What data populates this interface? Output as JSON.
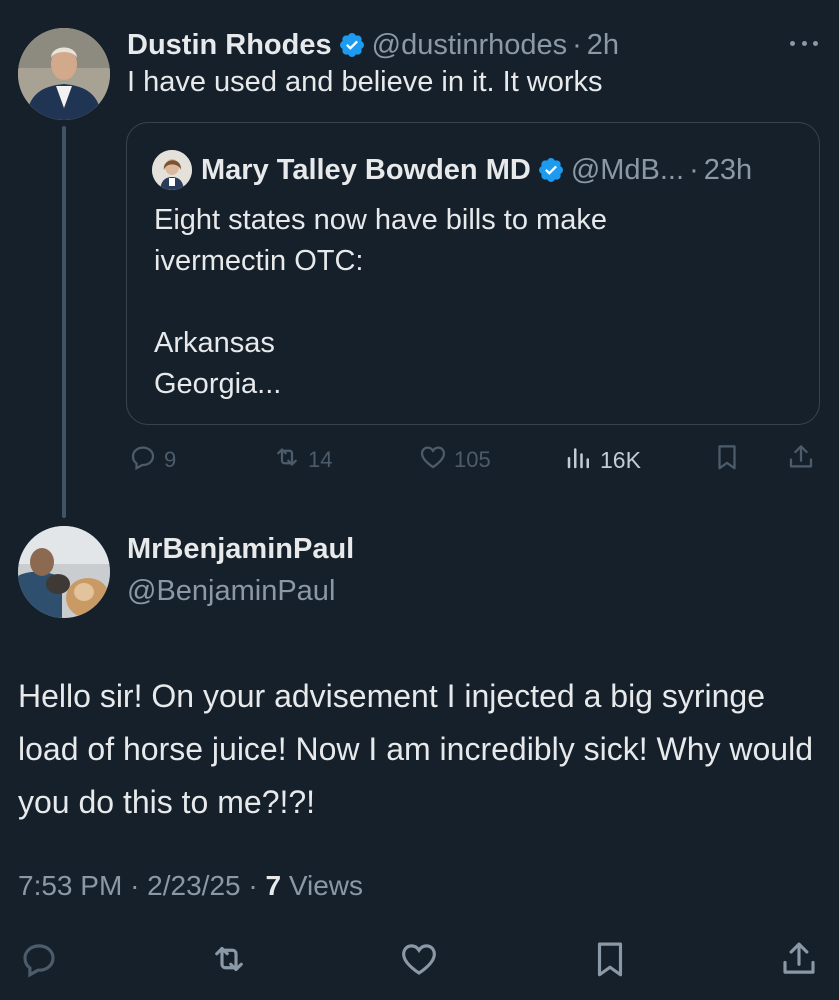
{
  "parent_tweet": {
    "display_name": "Dustin Rhodes",
    "handle": "@dustinrhodes",
    "separator": "·",
    "time": "2h",
    "text": "I have used and believe in it. It works",
    "quoted_tweet": {
      "display_name": "Mary Talley Bowden MD",
      "handle": "@MdB...",
      "separator": "·",
      "time": "23h",
      "text_lines": [
        "Eight states now have bills to make",
        "ivermectin OTC:",
        "",
        "Arkansas",
        "Georgia..."
      ]
    },
    "actions": {
      "replies": "9",
      "reposts": "14",
      "likes": "105",
      "views": "16K"
    }
  },
  "reply_tweet": {
    "display_name": "MrBenjaminPaul",
    "handle": "@BenjaminPaul",
    "text": "Hello sir! On your advisement I injected a big syringe load of horse juice! Now I am incredibly sick! Why would you do this to me?!?!",
    "time": "7:53 PM",
    "date": "2/23/25",
    "separator": "·",
    "views_count": "7",
    "views_label": "Views"
  },
  "colors": {
    "background": "#15202b",
    "text_primary": "#e7e9ea",
    "text_secondary": "#8b98a5",
    "verified": "#1d9bf0",
    "border": "#38444d"
  },
  "icons": {
    "verified": "verified-badge-icon",
    "reply": "reply-bubble-icon",
    "repost": "repost-icon",
    "like": "heart-icon",
    "views": "views-chart-icon",
    "bookmark": "bookmark-icon",
    "share": "share-icon",
    "more": "more-dots-icon"
  }
}
